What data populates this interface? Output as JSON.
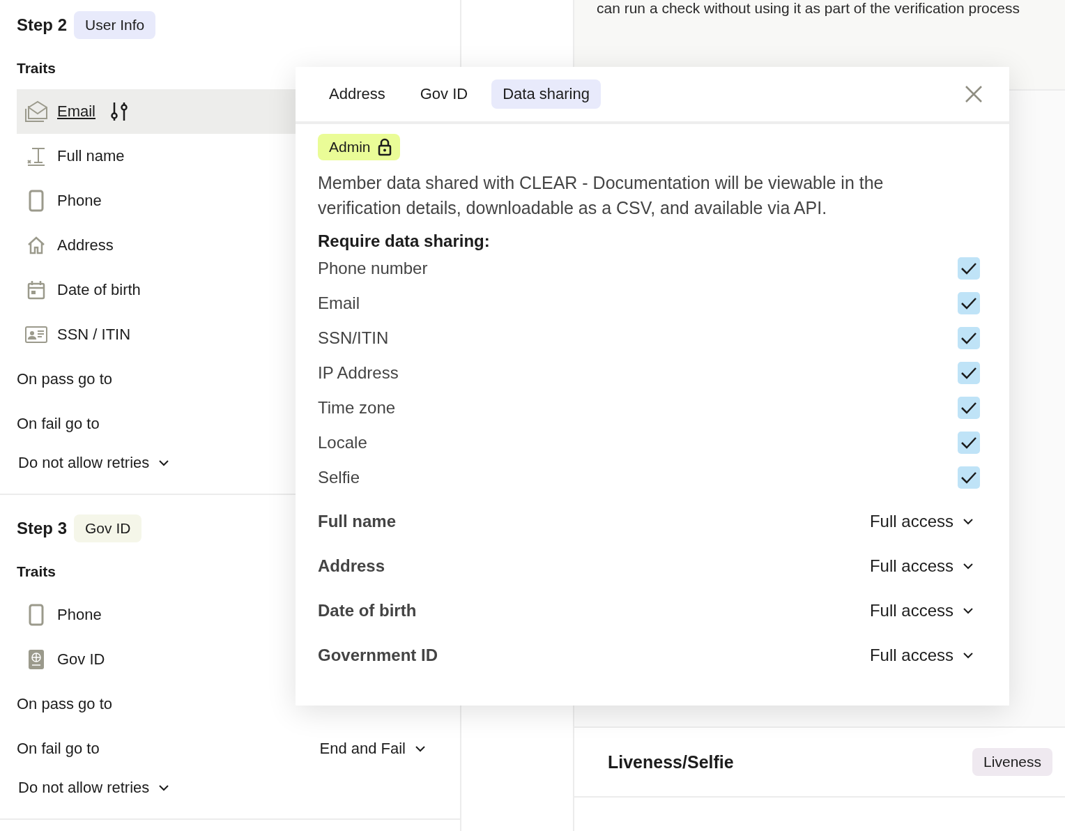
{
  "steps": [
    {
      "title": "Step 2",
      "badge": "User Info",
      "color": "#e8eafb",
      "traits_label": "Traits",
      "traits": [
        {
          "label": "Email",
          "kind": "email",
          "selected": true
        },
        {
          "label": "Full name",
          "kind": "name",
          "selected": false
        },
        {
          "label": "Phone",
          "kind": "phone",
          "selected": false
        },
        {
          "label": "Address",
          "kind": "address",
          "selected": false
        },
        {
          "label": "Date of birth",
          "kind": "date",
          "selected": false
        },
        {
          "label": "SSN / ITIN",
          "kind": "idcard",
          "selected": false
        }
      ],
      "pass_label": "On pass go to",
      "fail_label": "On fail go to",
      "retries": "Do not allow retries"
    },
    {
      "title": "Step 3",
      "badge": "Gov ID",
      "color": "#f5f6e9",
      "traits_label": "Traits",
      "traits": [
        {
          "label": "Phone",
          "kind": "phone",
          "selected": false
        },
        {
          "label": "Gov ID",
          "kind": "passport",
          "selected": false
        }
      ],
      "pass_label": "On pass go to",
      "fail_label": "On fail go to",
      "fail_value": "End and Fail",
      "retries": "Do not allow retries"
    }
  ],
  "right_panel": {
    "description": "can run a check without using it as part of the verification process",
    "card_title": "Liveness/Selfie",
    "card_badge": "Liveness"
  },
  "modal": {
    "tabs": [
      {
        "label": "Address",
        "selected": false
      },
      {
        "label": "Gov ID",
        "selected": false
      },
      {
        "label": "Data sharing",
        "selected": true
      }
    ],
    "admin_badge": "Admin",
    "description": "Member data shared with CLEAR - Documentation will be viewable in the verification details, downloadable as a CSV, and available via API.",
    "require_title": "Require data sharing:",
    "required_fields": [
      {
        "label": "Phone number",
        "checked": true
      },
      {
        "label": "Email",
        "checked": true
      },
      {
        "label": "SSN/ITIN",
        "checked": true
      },
      {
        "label": "IP Address",
        "checked": true
      },
      {
        "label": "Time zone",
        "checked": true
      },
      {
        "label": "Locale",
        "checked": true
      },
      {
        "label": "Selfie",
        "checked": true
      }
    ],
    "access": [
      {
        "label": "Full name",
        "value": "Full access"
      },
      {
        "label": "Address",
        "value": "Full access"
      },
      {
        "label": "Date of birth",
        "value": "Full access"
      },
      {
        "label": "Government ID",
        "value": "Full access"
      }
    ]
  }
}
